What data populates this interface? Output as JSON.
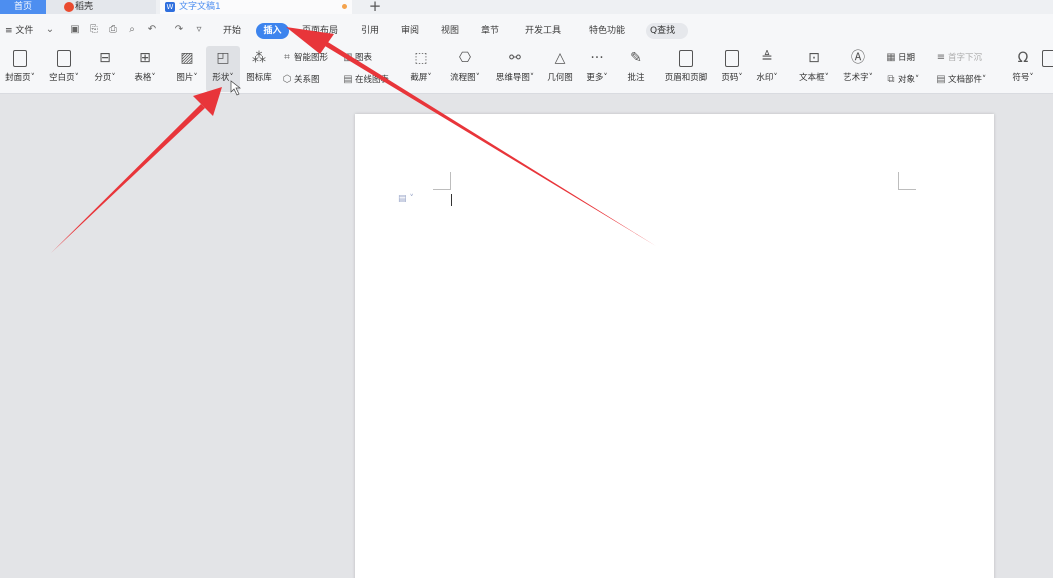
{
  "tabs": {
    "home": "首页",
    "daoke": "稻壳",
    "document": "文字文稿1",
    "new_tab": "+"
  },
  "menu": {
    "file": "≡ 文件",
    "items": [
      "开始",
      "插入",
      "页面布局",
      "引用",
      "审阅",
      "视图",
      "章节",
      "开发工具",
      "特色功能"
    ],
    "active": "插入",
    "search": "Q查找"
  },
  "ribbon": {
    "cover": "封面页",
    "blank": "空白页",
    "break": "分页",
    "table": "表格",
    "picture": "图片",
    "shape": "形状",
    "iconlib": "图标库",
    "smart": "智能图形",
    "chart": "图表",
    "relation": "关系图",
    "online_chart": "在线图表",
    "screenshot": "截屏",
    "flowchart": "流程图",
    "mindmap": "思维导图",
    "geometry": "几何图",
    "more": "更多",
    "comment": "批注",
    "header_footer": "页眉和页脚",
    "page_number": "页码",
    "watermark": "水印",
    "textbox": "文本框",
    "wordart": "艺术字",
    "date": "日期",
    "dropcap": "首字下沉",
    "object": "对象",
    "docpart": "文档部件",
    "symbol": "符号"
  },
  "colors": {
    "accent": "#3d84ee",
    "arrow": "#e8353a"
  }
}
